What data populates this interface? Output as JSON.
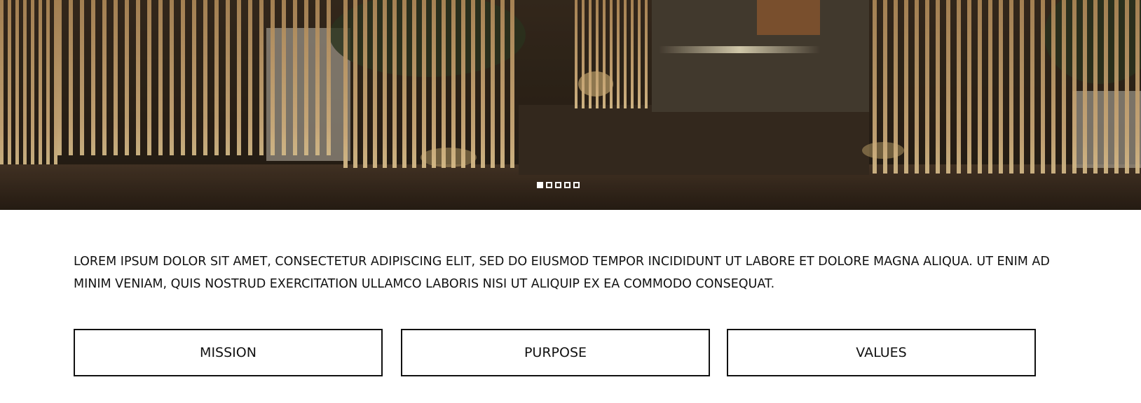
{
  "hero": {
    "slide_count": 5,
    "active_slide": 1
  },
  "intro": {
    "text": "LOREM IPSUM DOLOR SIT AMET, CONSECTETUR ADIPISCING ELIT, SED DO EIUSMOD TEMPOR INCIDIDUNT UT LABORE ET DOLORE MAGNA ALIQUA. UT ENIM AD MINIM VENIAM, QUIS NOSTRUD EXERCITATION ULLAMCO LABORIS NISI UT ALIQUIP EX EA COMMODO CONSEQUAT."
  },
  "tiles": [
    {
      "label": "MISSION"
    },
    {
      "label": "PURPOSE"
    },
    {
      "label": "VALUES"
    }
  ]
}
